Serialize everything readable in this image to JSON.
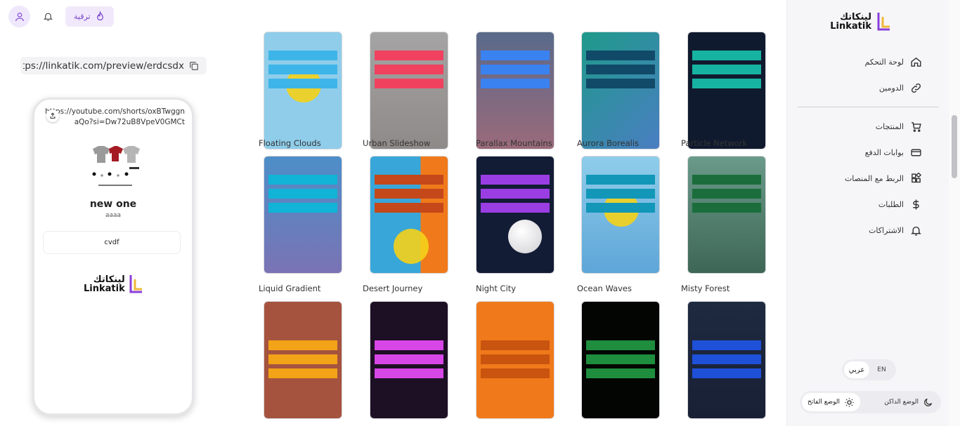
{
  "topbar": {
    "upgrade_label": "ترقية",
    "icons": {
      "profile": "user-icon",
      "notifications": "bell-icon",
      "upgrade": "flame-icon"
    }
  },
  "preview": {
    "url": "https://linkatik.com/preview/erdcsdx",
    "copy_icon": "copy-icon",
    "phone": {
      "link_text": "https://youtube.com/shorts/oxBTwggnaQo?si=Dw72uB8VpeV0GMCt",
      "share_icon": "share-icon",
      "profile_name": "new one",
      "profile_subtitle": "aaaa",
      "link_button": "cvdf",
      "logo_ar": "لينكاتك",
      "logo_en": "Linkatik"
    }
  },
  "templates": [
    {
      "name": "Floating Clouds",
      "bg": "#8fcdea",
      "bar": "#3eb5e8"
    },
    {
      "name": "Urban Slideshow",
      "bg": "#9a9898",
      "bar": "#f0425f"
    },
    {
      "name": "Parallax Mountains",
      "bg": "#6a6a88",
      "bar": "#3a82f0"
    },
    {
      "name": "Aurora Borealis",
      "bg": "#2c8f8c",
      "bar": "#104a68"
    },
    {
      "name": "Particle Network",
      "bg": "#101a2e",
      "bar": "#17b3a2"
    },
    {
      "name": "Liquid Gradient",
      "bg": "#5c8ec8",
      "bar": "#11b3d6"
    },
    {
      "name": "Desert Journey",
      "bg": "#3aa7d8",
      "bar": "#c4481a"
    },
    {
      "name": "Night City",
      "bg": "#131c35",
      "bar": "#9a3ee3"
    },
    {
      "name": "Ocean Waves",
      "bg": "#7fbde4",
      "bar": "#1297b8"
    },
    {
      "name": "Misty Forest",
      "bg": "#4b7a66",
      "bar": "#1b6e3c"
    },
    {
      "name": "",
      "bg": "#a5533e",
      "bar": "#f3a317"
    },
    {
      "name": "",
      "bg": "#1d0f24",
      "bar": "#d746e6"
    },
    {
      "name": "",
      "bg": "#f07a1b",
      "bar": "#c9540f"
    },
    {
      "name": "",
      "bg": "#020502",
      "bar": "#1e8d3d"
    },
    {
      "name": "",
      "bg": "#1c2638",
      "bar": "#1e50d8"
    }
  ],
  "sidebar": {
    "brand_ar": "لينكاتك",
    "brand_en": "Linkatik",
    "items": [
      {
        "label": "لوحة التحكم",
        "icon": "home-icon"
      },
      {
        "label": "الدومين",
        "icon": "link-icon"
      },
      {
        "label": "المنتجات",
        "icon": "cart-icon"
      },
      {
        "label": "بوابات الدفع",
        "icon": "card-icon"
      },
      {
        "label": "الربط مع المنصات",
        "icon": "apps-icon"
      },
      {
        "label": "الطلبات",
        "icon": "dollar-icon"
      },
      {
        "label": "الاشتراكات",
        "icon": "bell-icon"
      }
    ],
    "language": {
      "active": "عربي",
      "other": "EN"
    },
    "theme": {
      "light": "الوضع الفاتح",
      "dark": "الوضع الداكن"
    }
  }
}
